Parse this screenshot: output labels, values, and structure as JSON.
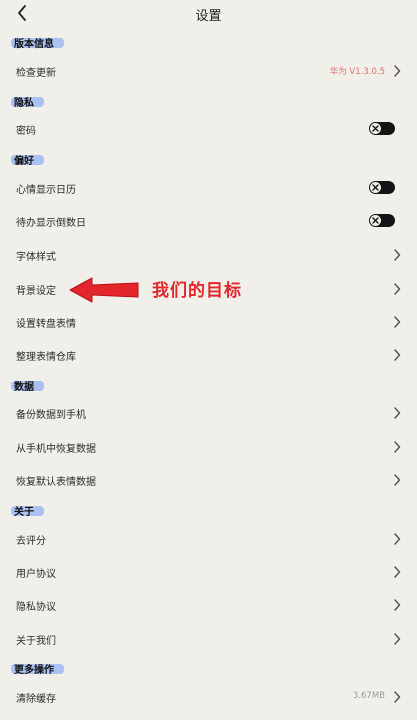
{
  "header": {
    "title": "设置"
  },
  "sections": {
    "version": "版本信息",
    "privacy": "隐私",
    "prefs": "偏好",
    "data": "数据",
    "about": "关于",
    "more": "更多操作"
  },
  "rows": {
    "check_update": {
      "label": "检查更新",
      "value": "华为 V1.3.0.5"
    },
    "password": {
      "label": "密码",
      "toggle": "off"
    },
    "mood_calendar": {
      "label": "心情显示日历",
      "toggle": "off"
    },
    "todo_countdown": {
      "label": "待办显示倒数日",
      "toggle": "off"
    },
    "font_style": {
      "label": "字体样式"
    },
    "background": {
      "label": "背景设定"
    },
    "wheel_emoji": {
      "label": "设置转盘表情"
    },
    "emoji_store": {
      "label": "整理表情仓库"
    },
    "backup": {
      "label": "备份数据到手机"
    },
    "restore": {
      "label": "从手机中恢复数据"
    },
    "restore_default": {
      "label": "恢复默认表情数据"
    },
    "rate": {
      "label": "去评分"
    },
    "user_agreement": {
      "label": "用户协议"
    },
    "privacy_policy": {
      "label": "隐私协议"
    },
    "about_us": {
      "label": "关于我们"
    },
    "clear_cache": {
      "label": "清除缓存",
      "value": "3.67MB"
    }
  },
  "annotation": {
    "text": "我们的目标",
    "color": "#e2262c"
  },
  "colors": {
    "background": "#f1efe9",
    "section_highlight": "#9fb9f3",
    "version_value": "#e07070",
    "toggle_track": "#141414"
  },
  "icons": {
    "back": "chevron-left-icon",
    "row_arrow": "chevron-right-icon",
    "toggle_off": "x-icon"
  }
}
